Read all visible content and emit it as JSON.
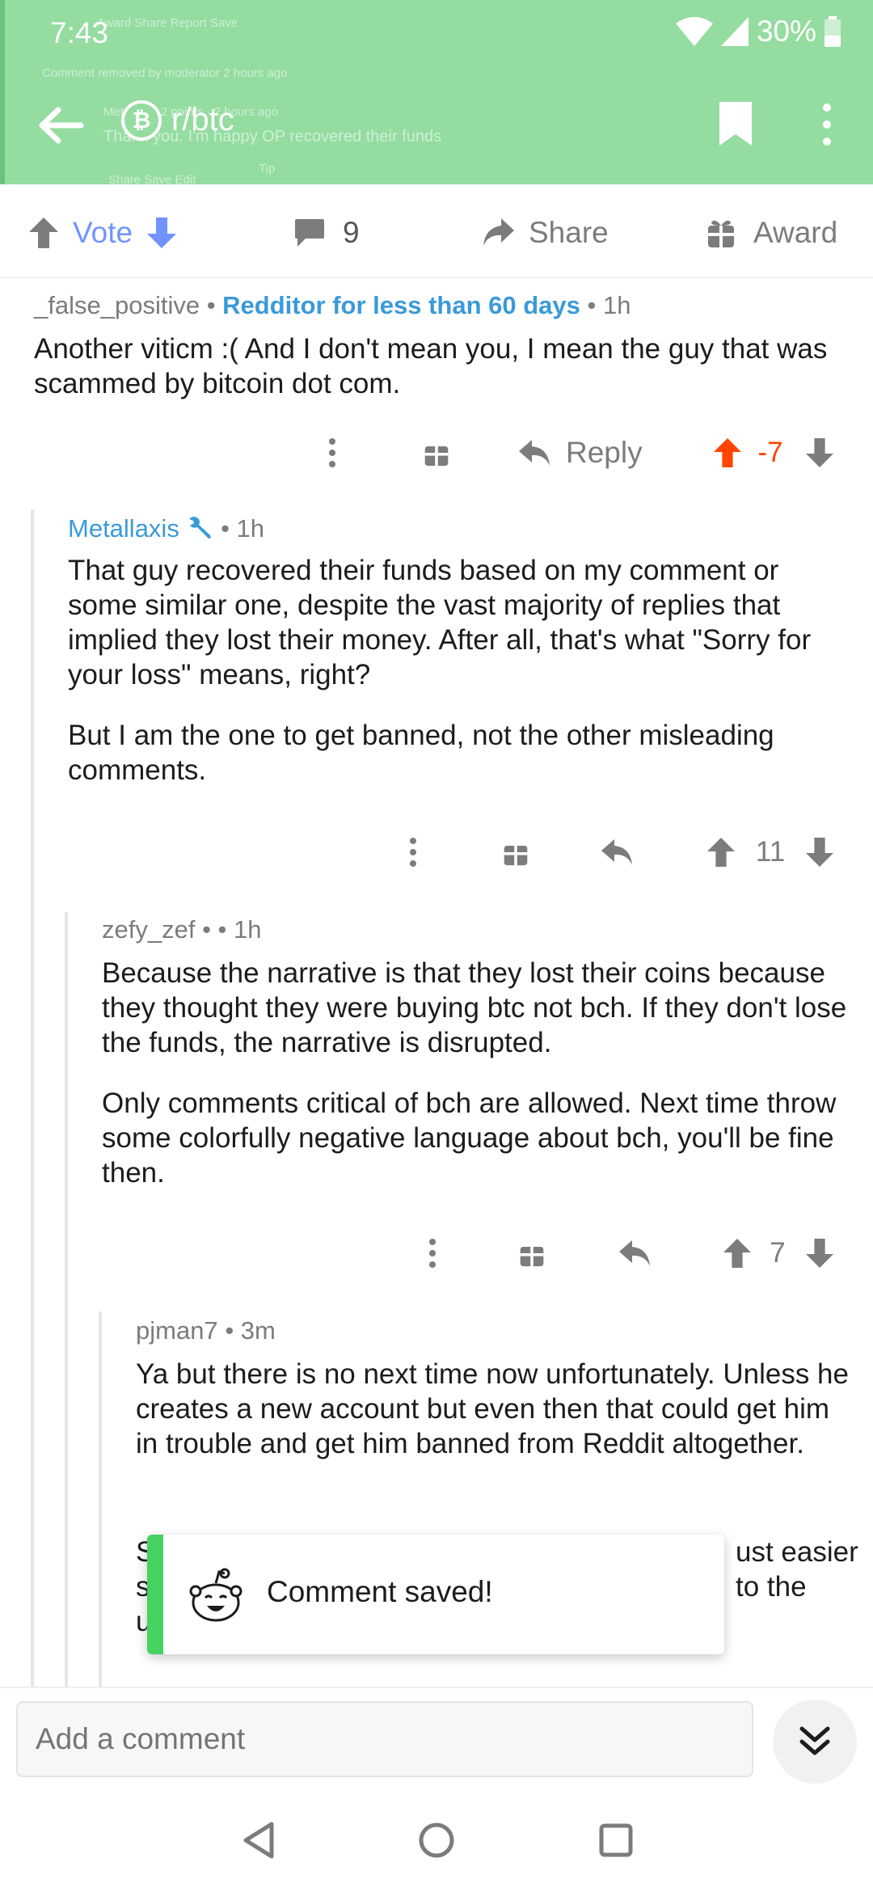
{
  "status_bar": {
    "time": "7:43",
    "battery": "30%"
  },
  "header": {
    "subreddit": "r/btc",
    "subreddit_icon": "bitcoin-icon",
    "bg_color": "#94dca0"
  },
  "header_ghost": {
    "line1": "Award   Share   Report   Save",
    "line2": "Comment removed by moderator   2 hours ago",
    "line3": "Metallaxis  2 points · 2 hours ago",
    "line4": "Thank you. I'm happy OP recovered their funds",
    "line5": "Share   Save   Edit",
    "line6": "Tip"
  },
  "post_actions": {
    "vote_label": "Vote",
    "comment_count": "9",
    "share_label": "Share",
    "award_label": "Award"
  },
  "comments": [
    {
      "author": "_false_positive",
      "flair": "Redditor for less than 60 days",
      "time": "1h",
      "body": [
        "Another viticm :( And I don't mean you, I mean the guy that was scammed by bitcoin dot com."
      ],
      "reply_label": "Reply",
      "score": "-7",
      "upvoted": true
    },
    {
      "author": "Metallaxis",
      "author_icon": "wrench-icon",
      "time": "1h",
      "body": [
        "That guy recovered their funds based on my comment or some similar one, despite the vast majority of replies that implied they lost their money. After all, that's what \"Sorry for your loss\" means, right?",
        "But I am the one to get banned, not the other misleading comments."
      ],
      "score": "11"
    },
    {
      "author": "zefy_zef",
      "time": "1h",
      "body": [
        "Because the narrative is that they lost their coins because they thought they were buying btc not bch. If they don't lose the funds, the narrative is disrupted.",
        "Only comments critical of bch are allowed. Next time throw some colorfully negative language about bch, you'll be fine then."
      ],
      "score": "7"
    },
    {
      "author": "pjman7",
      "time": "3m",
      "body": [
        "Ya but there is no next time now unfortunately. Unless he creates a new account but even then that could get him in trouble and get him banned from Reddit altogether."
      ],
      "partial_line1_left": "S",
      "partial_line1_right": "ust easier",
      "partial_line2_left": "s",
      "partial_line2_right": "to the",
      "partial_line3_left": "u"
    }
  ],
  "toast": {
    "message": "Comment saved!",
    "accent": "#46d160"
  },
  "composer": {
    "placeholder": "Add a comment"
  }
}
